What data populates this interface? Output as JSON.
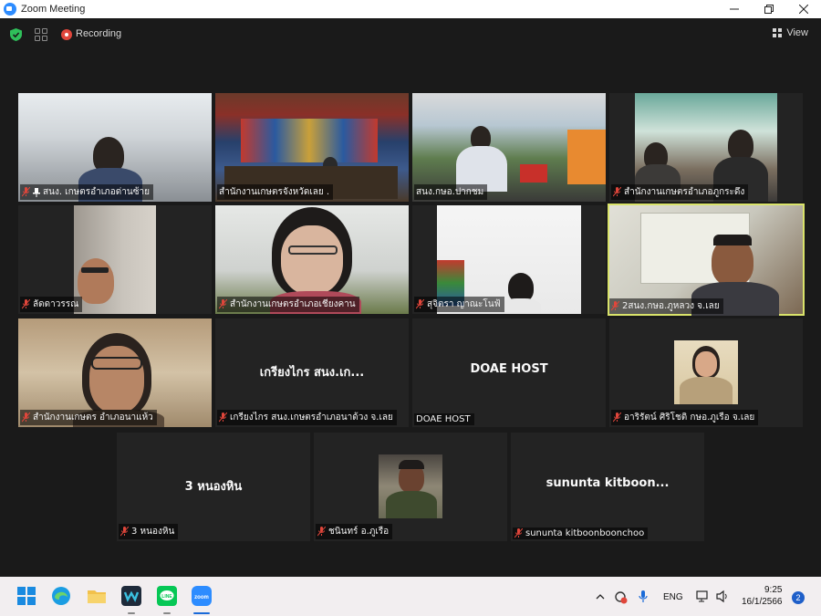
{
  "window": {
    "title": "Zoom Meeting",
    "minimize_icon": "minimize-icon",
    "maximize_icon": "maximize-icon",
    "close_icon": "close-icon"
  },
  "meeting_bar": {
    "recording_label": "Recording",
    "view_label": "View",
    "accent_green": "#2fbf5a",
    "recording_color": "#e0463b"
  },
  "participants": [
    {
      "name": "สนง. เกษตรอำเภอด่านซ้าย",
      "muted": true,
      "pinned": true,
      "video": true
    },
    {
      "name": "สำนักงานเกษตรจังหวัดเลย  .",
      "muted": false,
      "video": true
    },
    {
      "name": "สนง.กษอ.ปากชม",
      "muted": false,
      "video": true
    },
    {
      "name": "สำนักงานเกษตรอำเภอภูกระดึง",
      "muted": true,
      "video": true
    },
    {
      "name": "ลัดดาวรรณ",
      "muted": true,
      "video": true
    },
    {
      "name": "สำนักงานเกษตรอำเภอเชียงคาน",
      "muted": true,
      "video": true
    },
    {
      "name": "สุจิตรา  ญาณะโนฟ้",
      "muted": true,
      "video": true
    },
    {
      "name": "2สนง.กษอ.ภูหลวง จ.เลย",
      "muted": true,
      "video": true,
      "active_speaker": true
    },
    {
      "name": "สำนักงานเกษตร อำเภอนาแห้ว",
      "muted": true,
      "video": true
    },
    {
      "name": "เกรียงไกร สนง.เกษตรอำเภอนาด้วง จ.เลย",
      "display_name": "เกรียงไกร สนง.เก...",
      "muted": true,
      "video": false
    },
    {
      "name": "DOAE HOST",
      "display_name": "DOAE HOST",
      "muted": false,
      "video": false
    },
    {
      "name": "อาริรัตน์ ศิริโชติ กษอ.ภูเรือ จ.เลย",
      "muted": true,
      "video": true
    },
    {
      "name": "3 หนองหิน",
      "display_name": "3 หนองหิน",
      "muted": true,
      "video": false
    },
    {
      "name": "ชนินทร์ อ.ภูเรือ",
      "muted": true,
      "video": true
    },
    {
      "name": "sununta kitboonboonchoo",
      "display_name": "sununta  kitboon...",
      "muted": true,
      "video": false
    }
  ],
  "taskbar": {
    "apps": [
      "start-icon",
      "edge-icon",
      "file-explorer-icon",
      "webex-icon",
      "line-icon",
      "zoom-icon"
    ],
    "language": "ENG",
    "time": "9:25",
    "date": "16/1/2566",
    "notification_count": "2"
  }
}
